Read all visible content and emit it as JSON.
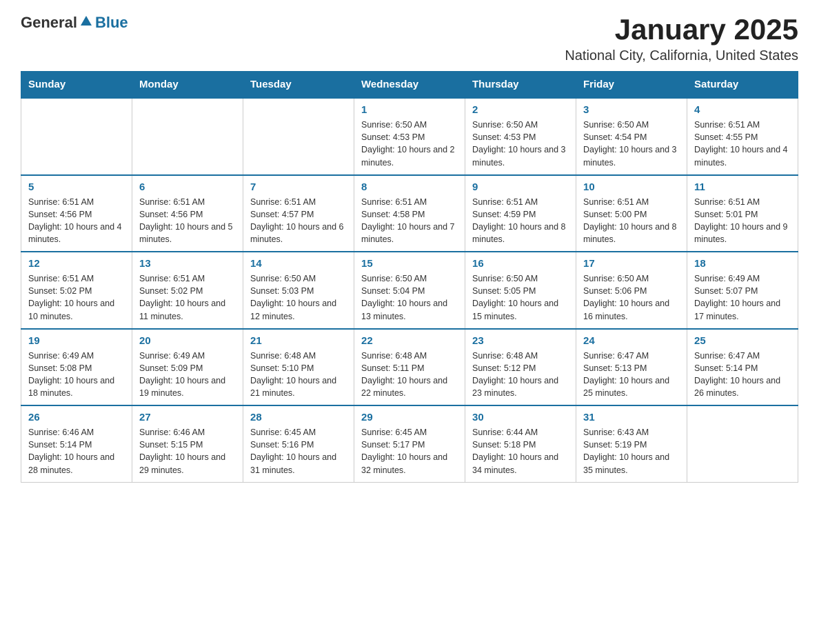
{
  "header": {
    "logo_general": "General",
    "logo_blue": "Blue",
    "title": "January 2025",
    "subtitle": "National City, California, United States"
  },
  "days_of_week": [
    "Sunday",
    "Monday",
    "Tuesday",
    "Wednesday",
    "Thursday",
    "Friday",
    "Saturday"
  ],
  "weeks": [
    [
      {
        "day": "",
        "info": ""
      },
      {
        "day": "",
        "info": ""
      },
      {
        "day": "",
        "info": ""
      },
      {
        "day": "1",
        "info": "Sunrise: 6:50 AM\nSunset: 4:53 PM\nDaylight: 10 hours and 2 minutes."
      },
      {
        "day": "2",
        "info": "Sunrise: 6:50 AM\nSunset: 4:53 PM\nDaylight: 10 hours and 3 minutes."
      },
      {
        "day": "3",
        "info": "Sunrise: 6:50 AM\nSunset: 4:54 PM\nDaylight: 10 hours and 3 minutes."
      },
      {
        "day": "4",
        "info": "Sunrise: 6:51 AM\nSunset: 4:55 PM\nDaylight: 10 hours and 4 minutes."
      }
    ],
    [
      {
        "day": "5",
        "info": "Sunrise: 6:51 AM\nSunset: 4:56 PM\nDaylight: 10 hours and 4 minutes."
      },
      {
        "day": "6",
        "info": "Sunrise: 6:51 AM\nSunset: 4:56 PM\nDaylight: 10 hours and 5 minutes."
      },
      {
        "day": "7",
        "info": "Sunrise: 6:51 AM\nSunset: 4:57 PM\nDaylight: 10 hours and 6 minutes."
      },
      {
        "day": "8",
        "info": "Sunrise: 6:51 AM\nSunset: 4:58 PM\nDaylight: 10 hours and 7 minutes."
      },
      {
        "day": "9",
        "info": "Sunrise: 6:51 AM\nSunset: 4:59 PM\nDaylight: 10 hours and 8 minutes."
      },
      {
        "day": "10",
        "info": "Sunrise: 6:51 AM\nSunset: 5:00 PM\nDaylight: 10 hours and 8 minutes."
      },
      {
        "day": "11",
        "info": "Sunrise: 6:51 AM\nSunset: 5:01 PM\nDaylight: 10 hours and 9 minutes."
      }
    ],
    [
      {
        "day": "12",
        "info": "Sunrise: 6:51 AM\nSunset: 5:02 PM\nDaylight: 10 hours and 10 minutes."
      },
      {
        "day": "13",
        "info": "Sunrise: 6:51 AM\nSunset: 5:02 PM\nDaylight: 10 hours and 11 minutes."
      },
      {
        "day": "14",
        "info": "Sunrise: 6:50 AM\nSunset: 5:03 PM\nDaylight: 10 hours and 12 minutes."
      },
      {
        "day": "15",
        "info": "Sunrise: 6:50 AM\nSunset: 5:04 PM\nDaylight: 10 hours and 13 minutes."
      },
      {
        "day": "16",
        "info": "Sunrise: 6:50 AM\nSunset: 5:05 PM\nDaylight: 10 hours and 15 minutes."
      },
      {
        "day": "17",
        "info": "Sunrise: 6:50 AM\nSunset: 5:06 PM\nDaylight: 10 hours and 16 minutes."
      },
      {
        "day": "18",
        "info": "Sunrise: 6:49 AM\nSunset: 5:07 PM\nDaylight: 10 hours and 17 minutes."
      }
    ],
    [
      {
        "day": "19",
        "info": "Sunrise: 6:49 AM\nSunset: 5:08 PM\nDaylight: 10 hours and 18 minutes."
      },
      {
        "day": "20",
        "info": "Sunrise: 6:49 AM\nSunset: 5:09 PM\nDaylight: 10 hours and 19 minutes."
      },
      {
        "day": "21",
        "info": "Sunrise: 6:48 AM\nSunset: 5:10 PM\nDaylight: 10 hours and 21 minutes."
      },
      {
        "day": "22",
        "info": "Sunrise: 6:48 AM\nSunset: 5:11 PM\nDaylight: 10 hours and 22 minutes."
      },
      {
        "day": "23",
        "info": "Sunrise: 6:48 AM\nSunset: 5:12 PM\nDaylight: 10 hours and 23 minutes."
      },
      {
        "day": "24",
        "info": "Sunrise: 6:47 AM\nSunset: 5:13 PM\nDaylight: 10 hours and 25 minutes."
      },
      {
        "day": "25",
        "info": "Sunrise: 6:47 AM\nSunset: 5:14 PM\nDaylight: 10 hours and 26 minutes."
      }
    ],
    [
      {
        "day": "26",
        "info": "Sunrise: 6:46 AM\nSunset: 5:14 PM\nDaylight: 10 hours and 28 minutes."
      },
      {
        "day": "27",
        "info": "Sunrise: 6:46 AM\nSunset: 5:15 PM\nDaylight: 10 hours and 29 minutes."
      },
      {
        "day": "28",
        "info": "Sunrise: 6:45 AM\nSunset: 5:16 PM\nDaylight: 10 hours and 31 minutes."
      },
      {
        "day": "29",
        "info": "Sunrise: 6:45 AM\nSunset: 5:17 PM\nDaylight: 10 hours and 32 minutes."
      },
      {
        "day": "30",
        "info": "Sunrise: 6:44 AM\nSunset: 5:18 PM\nDaylight: 10 hours and 34 minutes."
      },
      {
        "day": "31",
        "info": "Sunrise: 6:43 AM\nSunset: 5:19 PM\nDaylight: 10 hours and 35 minutes."
      },
      {
        "day": "",
        "info": ""
      }
    ]
  ]
}
